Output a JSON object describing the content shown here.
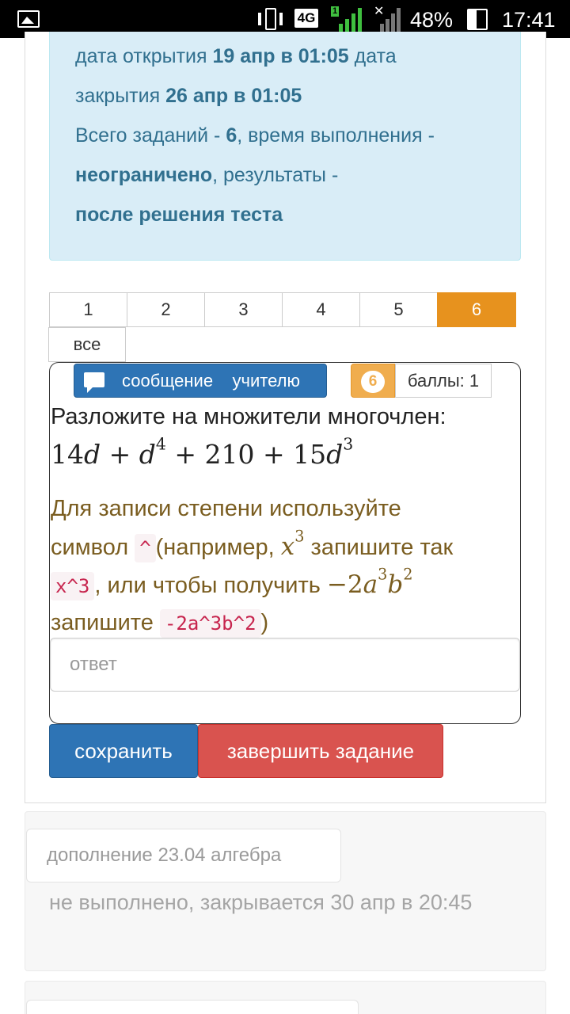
{
  "status_bar": {
    "network": "4G",
    "sim_slot": "1",
    "battery": "48%",
    "time": "17:41"
  },
  "info": {
    "l1_a": "дата открытия ",
    "l1_b": "19 апр в 01:05",
    "l1_c": " дата",
    "l2_a": "закрытия ",
    "l2_b": "26 апр в 01:05",
    "l3_a": "Всего заданий - ",
    "l3_b": "6",
    "l3_c": ", время выполнения -",
    "l4_a": "неограничено",
    "l4_b": ", результаты -",
    "l5_a": "после решения теста"
  },
  "pagination": {
    "pages": [
      "1",
      "2",
      "3",
      "4",
      "5",
      "6"
    ],
    "active": "6",
    "all": "все"
  },
  "task": {
    "message_button": "сообщение    учителю",
    "task_number": "6",
    "points": "баллы: 1",
    "question": "Разложите на множители многочлен:",
    "expr": {
      "t1": "14",
      "v1": "d",
      "op1": " + ",
      "v2": "d",
      "e2": "4",
      "op2": " + 210 + 15",
      "v3": "d",
      "e3": "3"
    },
    "hint": {
      "h1": "Для записи степени используйте",
      "h2": "символ ",
      "code1": "^",
      "h3": "(например, ",
      "mx": "x",
      "mx_exp": "3",
      "h4": " запишите так",
      "code2": "x^3",
      "h5": ", или чтобы получить ",
      "m2": "−2",
      "ma": "a",
      "ma_exp": "3",
      "mb": "b",
      "mb_exp": "2",
      "h6": "запишите ",
      "code3": "-2a^3b^2",
      "h7": ")"
    },
    "answer_placeholder": "ответ",
    "save_button": "сохранить",
    "finish_button": "завершить задание"
  },
  "next_assignment": {
    "title": "дополнение 23.04 алгебра",
    "status": "не выполнено, закрывается 30 апр в 20:45"
  },
  "colors": {
    "info_bg": "#d9edf7",
    "info_text": "#31708f",
    "primary": "#2e74b5",
    "danger": "#d9534f",
    "warning": "#f0ad4e",
    "active_page": "#e7921e",
    "hint_text": "#7a5d20"
  }
}
